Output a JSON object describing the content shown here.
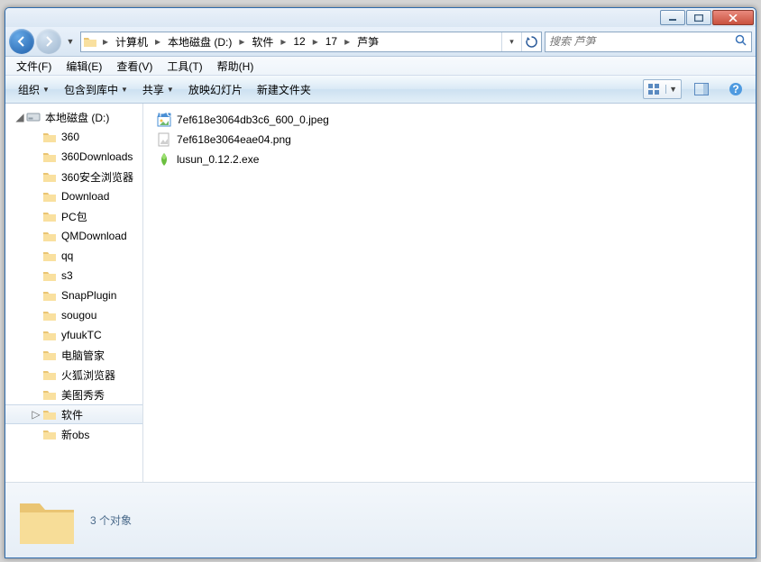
{
  "window_controls": {
    "minimize": "minimize",
    "maximize": "maximize",
    "close": "close"
  },
  "breadcrumbs": [
    "计算机",
    "本地磁盘 (D:)",
    "软件",
    "12",
    "17",
    "芦笋"
  ],
  "search": {
    "placeholder": "搜索 芦笋"
  },
  "menu": {
    "file": "文件(F)",
    "edit": "编辑(E)",
    "view": "查看(V)",
    "tools": "工具(T)",
    "help": "帮助(H)"
  },
  "toolbar": {
    "organize": "组织",
    "include": "包含到库中",
    "share": "共享",
    "slideshow": "放映幻灯片",
    "newfolder": "新建文件夹"
  },
  "tree": {
    "root": "本地磁盘 (D:)",
    "items": [
      "360",
      "360Downloads",
      "360安全浏览器",
      "Download",
      "PC包",
      "QMDownload",
      "qq",
      "s3",
      "SnapPlugin",
      "sougou",
      "yfuukTC",
      "电脑管家",
      "火狐浏览器",
      "美图秀秀",
      "软件",
      "新obs"
    ],
    "selected_index": 14
  },
  "files": [
    {
      "name": "7ef618e3064db3c6_600_0.jpeg",
      "type": "jpeg"
    },
    {
      "name": "7ef618e3064eae04.png",
      "type": "png"
    },
    {
      "name": "lusun_0.12.2.exe",
      "type": "exe"
    }
  ],
  "status": {
    "count_text": "3 个对象"
  }
}
